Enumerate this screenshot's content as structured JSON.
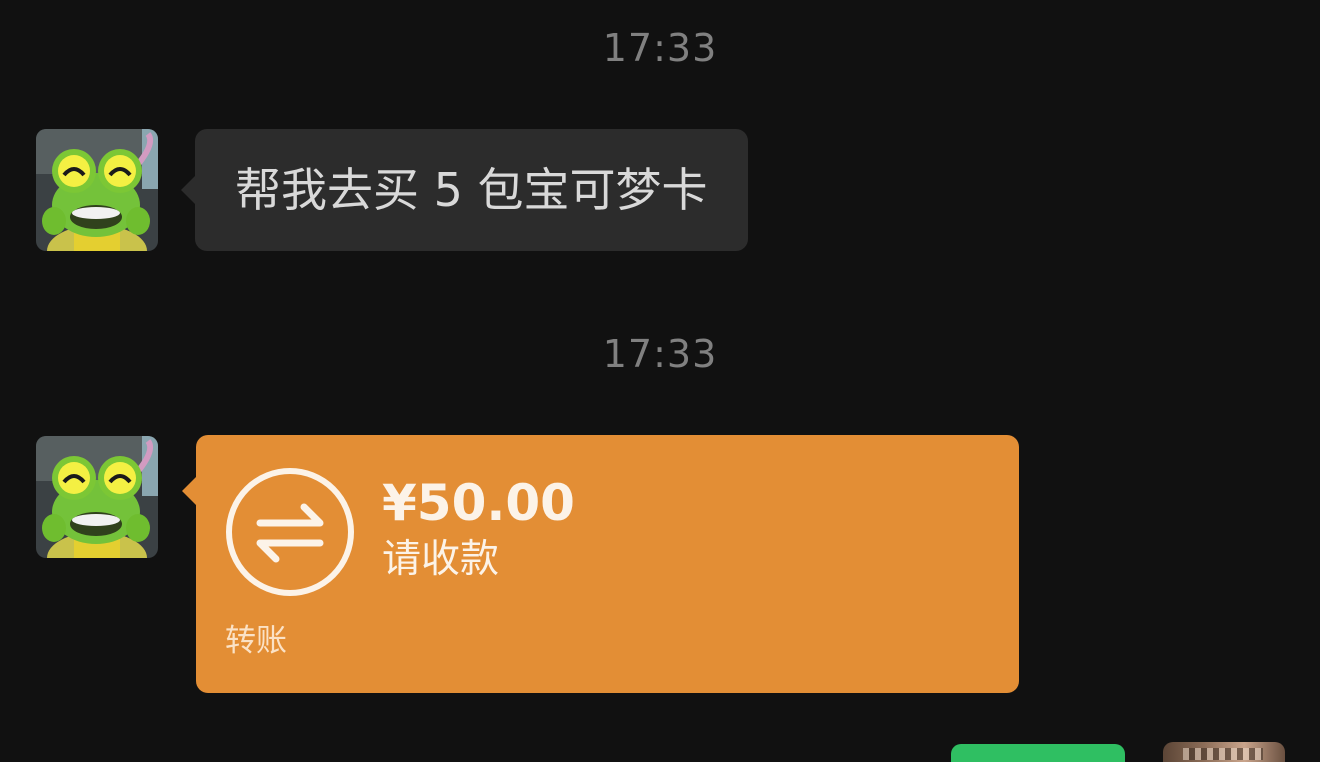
{
  "messages": [
    {
      "timestamp": "17:33",
      "type": "text",
      "text": "帮我去买 5 包宝可梦卡"
    },
    {
      "timestamp": "17:33",
      "type": "transfer",
      "amount": "¥50.00",
      "action": "请收款",
      "label": "转账"
    }
  ],
  "colors": {
    "background": "#111111",
    "incoming_bubble": "#2c2c2c",
    "transfer_card": "#e38e35",
    "outgoing_bubble": "#2fbf62"
  },
  "icons": {
    "transfer": "transfer-arrows-icon",
    "avatar": "frog-avatar"
  }
}
